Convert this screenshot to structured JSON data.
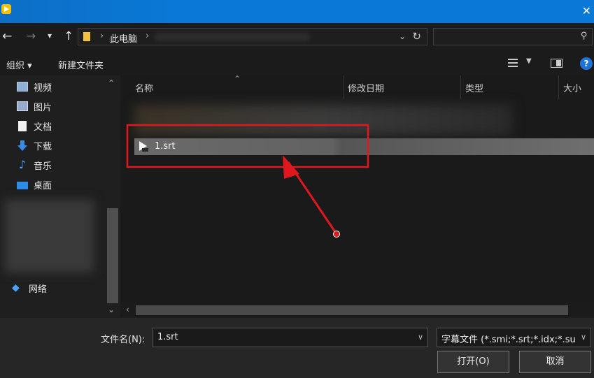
{
  "window": {
    "close_label": "✕"
  },
  "nav": {
    "back_icon": "arrow-left-icon",
    "forward_icon": "arrow-right-icon",
    "recent_icon": "chevron-down-icon",
    "up_icon": "arrow-up-icon"
  },
  "address": {
    "location": "此电脑",
    "separator": "›"
  },
  "search": {
    "placeholder": ""
  },
  "toolbar": {
    "organize_label": "组织 ▾",
    "new_folder_label": "新建文件夹",
    "help_label": "?"
  },
  "sidebar": {
    "items": [
      {
        "label": "视频",
        "icon": "video-folder-icon"
      },
      {
        "label": "图片",
        "icon": "pictures-folder-icon"
      },
      {
        "label": "文档",
        "icon": "documents-folder-icon"
      },
      {
        "label": "下载",
        "icon": "download-folder-icon"
      },
      {
        "label": "音乐",
        "icon": "music-folder-icon"
      },
      {
        "label": "桌面",
        "icon": "desktop-folder-icon"
      }
    ],
    "network_label": "网络"
  },
  "columns": {
    "name": "名称",
    "modified": "修改日期",
    "type": "类型",
    "size": "大小"
  },
  "files": [
    {
      "name": "1.srt",
      "selected": true,
      "icon": "subtitle-file-icon"
    }
  ],
  "bottom": {
    "filename_label": "文件名(N):",
    "filename_value": "1.srt",
    "filetype_value": "字幕文件 (*.smi;*.srt;*.idx;*.su",
    "open_label": "打开(O)",
    "cancel_label": "取消"
  },
  "colors": {
    "titlebar": "#0a78d7",
    "annotation": "#e0181e",
    "selection": "#6a6a6a"
  }
}
